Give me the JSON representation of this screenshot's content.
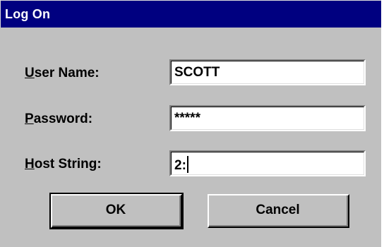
{
  "window": {
    "title": "Log On"
  },
  "form": {
    "user_name": {
      "mnemonic": "U",
      "label_rest": "ser Name:",
      "value": "SCOTT"
    },
    "password": {
      "mnemonic": "P",
      "label_rest": "assword:",
      "value": "*****"
    },
    "host_string": {
      "mnemonic": "H",
      "label_rest": "ost String:",
      "value": "2:"
    }
  },
  "buttons": {
    "ok_label": "OK",
    "cancel_label": "Cancel"
  },
  "colors": {
    "titlebar": "#000080",
    "dialog_bg": "#c0c0c0",
    "field_bg": "#ffffff"
  }
}
